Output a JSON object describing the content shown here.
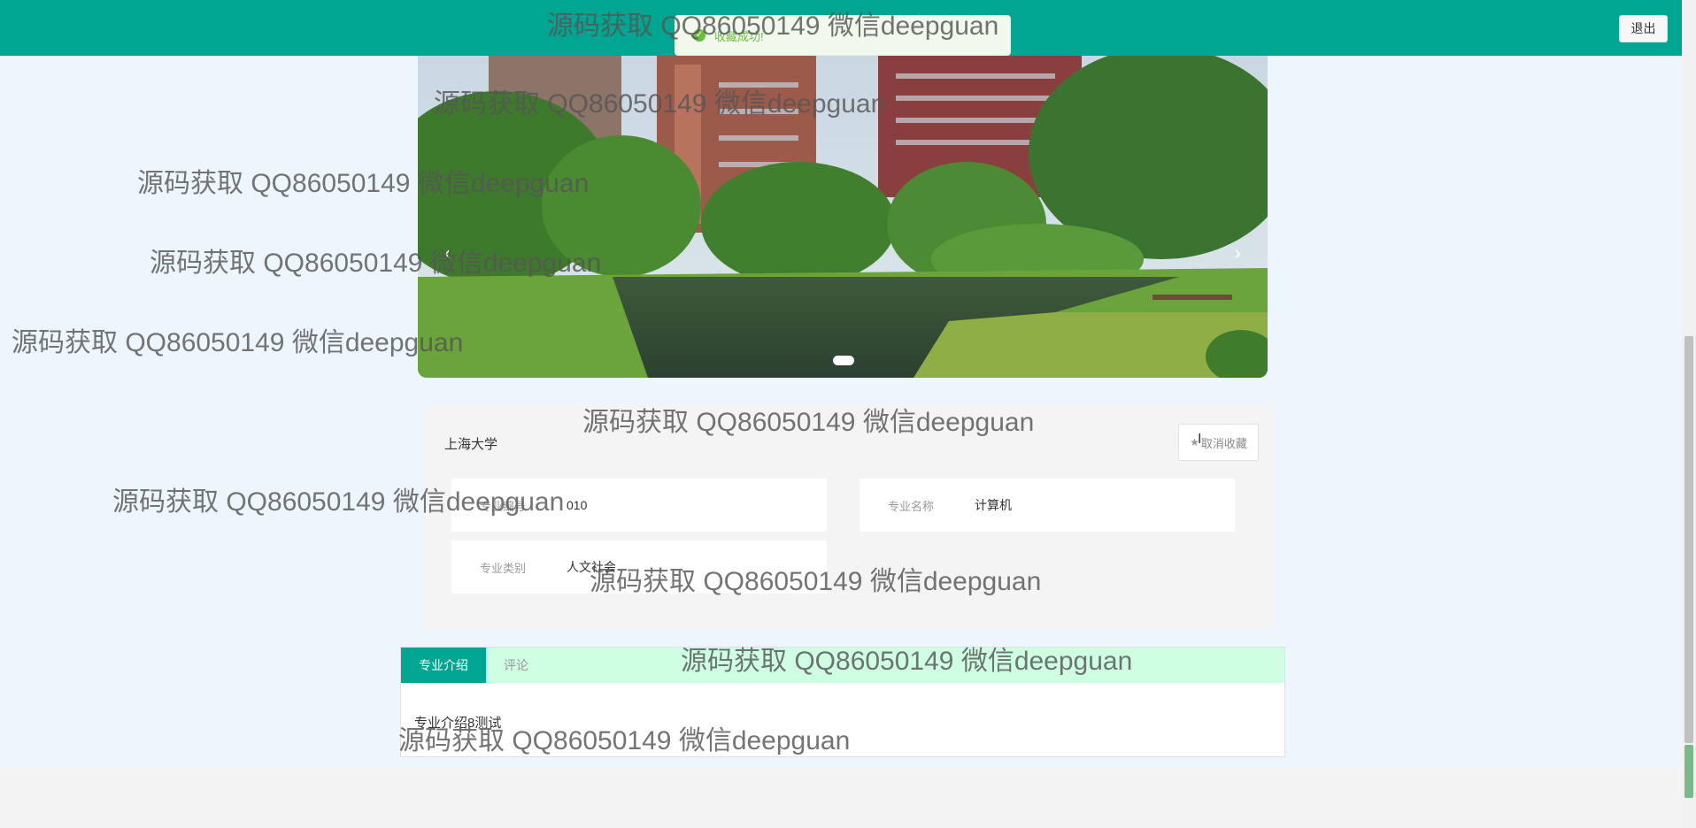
{
  "header": {
    "logout_label": "退出"
  },
  "toast": {
    "message": "收藏成功!"
  },
  "carousel": {
    "prev_icon": "‹",
    "next_icon": "›"
  },
  "detail": {
    "school_name": "上海大学",
    "favorite_button": "取消收藏",
    "fields": [
      {
        "label": "专业编号",
        "value": "010"
      },
      {
        "label": "专业名称",
        "value": "计算机"
      },
      {
        "label": "专业类别",
        "value": "人文社会"
      }
    ]
  },
  "tabs": {
    "items": [
      {
        "label": "专业介绍"
      },
      {
        "label": "评论"
      }
    ],
    "active_content": "专业介绍8测试"
  },
  "watermark": "源码获取 QQ86050149 微信deepguan",
  "colors": {
    "brand": "#00a692",
    "tab_bar": "#cfffe3",
    "success": "#67c23a"
  }
}
